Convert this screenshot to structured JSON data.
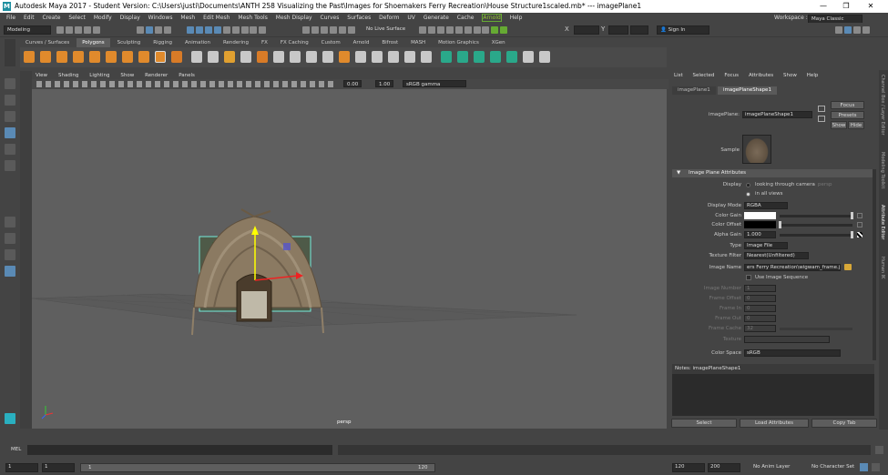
{
  "window": {
    "title": "Autodesk Maya 2017 - Student Version: C:\\Users\\justi\\Documents\\ANTH 258 Visualizing the Past\\Images for Shoemakers Ferry Recreation\\House Structure1scaled.mb*  ---  imagePlane1",
    "logo": "M",
    "minimize": "—",
    "maximize": "❐",
    "close": "✕"
  },
  "menubar": [
    "File",
    "Edit",
    "Create",
    "Select",
    "Modify",
    "Display",
    "Windows",
    "Mesh",
    "Edit Mesh",
    "Mesh Tools",
    "Mesh Display",
    "Curves",
    "Surfaces",
    "Deform",
    "UV",
    "Generate",
    "Cache",
    "Arnold",
    "Help"
  ],
  "toolbar": {
    "mode": "Modeling",
    "no_live_surface": "No Live Surface",
    "sign_in": "Sign In",
    "workspace_label": "Workspace :",
    "workspace_value": "Maya Classic"
  },
  "shelf_tabs": [
    "Curves / Surfaces",
    "Polygons",
    "Sculpting",
    "Rigging",
    "Animation",
    "Rendering",
    "FX",
    "FX Caching",
    "Custom",
    "Arnold",
    "Bifrost",
    "MASH",
    "Motion Graphics",
    "XGen"
  ],
  "shelf_active": "Polygons",
  "viewport": {
    "menu": [
      "View",
      "Shading",
      "Lighting",
      "Show",
      "Renderer",
      "Panels"
    ],
    "near": "0.00",
    "far": "1.00",
    "color_space": "sRGB gamma",
    "camera": "persp"
  },
  "attribute_editor": {
    "menu": [
      "List",
      "Selected",
      "Focus",
      "Attributes",
      "Show",
      "Help"
    ],
    "tabs": [
      "imagePlane1",
      "imagePlaneShape1"
    ],
    "active_tab": "imagePlaneShape1",
    "image_plane_label": "imagePlane:",
    "image_plane_value": "imagePlaneShape1",
    "focus_btn": "Focus",
    "presets_btn": "Presets",
    "show_btn": "Show",
    "hide_btn": "Hide",
    "sample_label": "Sample",
    "section_title": "Image Plane Attributes",
    "display_label": "Display",
    "display_opt1": "looking through camera",
    "display_opt1_extra": "persp",
    "display_opt2": "in all views",
    "display_mode_label": "Display Mode",
    "display_mode_value": "RGBA",
    "color_gain_label": "Color Gain",
    "color_offset_label": "Color Offset",
    "alpha_gain_label": "Alpha Gain",
    "alpha_gain_value": "1.000",
    "type_label": "Type",
    "type_value": "Image File",
    "texture_filter_label": "Texture Filter",
    "texture_filter_value": "Nearest(Unfiltered)",
    "image_name_label": "Image Name",
    "image_name_value": "ers Ferry Recreation\\wigwam_frame.jpg",
    "use_sequence_label": "Use Image Sequence",
    "image_number_label": "Image Number",
    "image_number_value": "1",
    "frame_offset_label": "Frame Offset",
    "frame_offset_value": "0",
    "frame_in_label": "Frame In",
    "frame_in_value": "0",
    "frame_out_label": "Frame Out",
    "frame_out_value": "0",
    "frame_cache_label": "Frame Cache",
    "frame_cache_value": "32",
    "texture_label": "Texture",
    "color_space_label": "Color Space",
    "color_space_value": "sRGB",
    "notes_label": "Notes: imagePlaneShape1",
    "select_btn": "Select",
    "load_attributes_btn": "Load Attributes",
    "copy_tab_btn": "Copy Tab"
  },
  "side_tabs": [
    "Channel Box / Layer Editor",
    "Modeling Toolkit",
    "Attribute Editor",
    "Human IK"
  ],
  "command_line": {
    "mel_label": "MEL"
  },
  "timeline": {
    "start": "1",
    "current": "1",
    "range_start": "1",
    "range_end": "120",
    "end": "120",
    "max": "200",
    "anim_layer": "No Anim Layer",
    "char_set": "No Character Set"
  },
  "colors": {
    "accent": "#5d5d5d",
    "bg": "#444444",
    "viewport": "#5f5f5f"
  }
}
